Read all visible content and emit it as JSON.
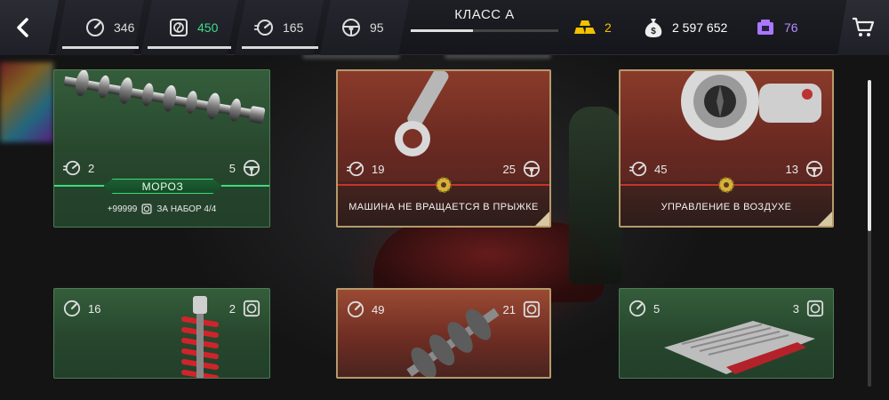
{
  "topbar": {
    "back_icon": "chevron-left-icon",
    "stats": [
      {
        "icon": "speedometer-icon",
        "value": "346"
      },
      {
        "icon": "turbo-icon",
        "value": "450"
      },
      {
        "icon": "acceleration-icon",
        "value": "165"
      },
      {
        "icon": "steering-wheel-icon",
        "value": "95"
      }
    ],
    "class_label": "КЛАСС A",
    "class_progress": 0.42,
    "currencies": [
      {
        "icon": "gold-bars-icon",
        "value": "2",
        "color": "#f2c200"
      },
      {
        "icon": "money-bag-icon",
        "value": "2 597 652",
        "color": "#ffffff"
      },
      {
        "icon": "tickets-icon",
        "value": "76",
        "color": "#b58cff"
      }
    ],
    "cart_icon": "shopping-cart-icon"
  },
  "cards": [
    {
      "part": "camshaft",
      "style": "green",
      "left_stat": "2",
      "left_icon": "acceleration-icon",
      "right_stat": "5",
      "right_icon": "steering-wheel-icon",
      "tag": "МОРОЗ",
      "bonus_prefix": "+99999",
      "bonus_suffix": "ЗА НАБОР 4/4"
    },
    {
      "part": "connecting-rod",
      "style": "red",
      "left_stat": "19",
      "left_icon": "acceleration-icon",
      "right_stat": "25",
      "right_icon": "steering-wheel-icon",
      "bonus_text": "МАШИНА НЕ ВРАЩАЕТСЯ В ПРЫЖКЕ"
    },
    {
      "part": "turbocharger",
      "style": "red",
      "left_stat": "45",
      "left_icon": "acceleration-icon",
      "right_stat": "13",
      "right_icon": "steering-wheel-icon",
      "bonus_text": "УПРАВЛЕНИЕ В ВОЗДУХЕ"
    },
    {
      "part": "shock-absorber",
      "style": "green",
      "left_stat": "16",
      "left_icon": "speedometer-icon",
      "right_stat": "2",
      "right_icon": "turbo-icon"
    },
    {
      "part": "crankshaft",
      "style": "red",
      "left_stat": "49",
      "left_icon": "speedometer-icon",
      "right_stat": "21",
      "right_icon": "turbo-icon"
    },
    {
      "part": "ecu",
      "style": "green",
      "left_stat": "5",
      "left_icon": "speedometer-icon",
      "right_stat": "3",
      "right_icon": "turbo-icon"
    }
  ],
  "colors": {
    "accent_green": "#3edb7a",
    "accent_red": "#c9302c",
    "gold_border": "#b69a6b"
  }
}
